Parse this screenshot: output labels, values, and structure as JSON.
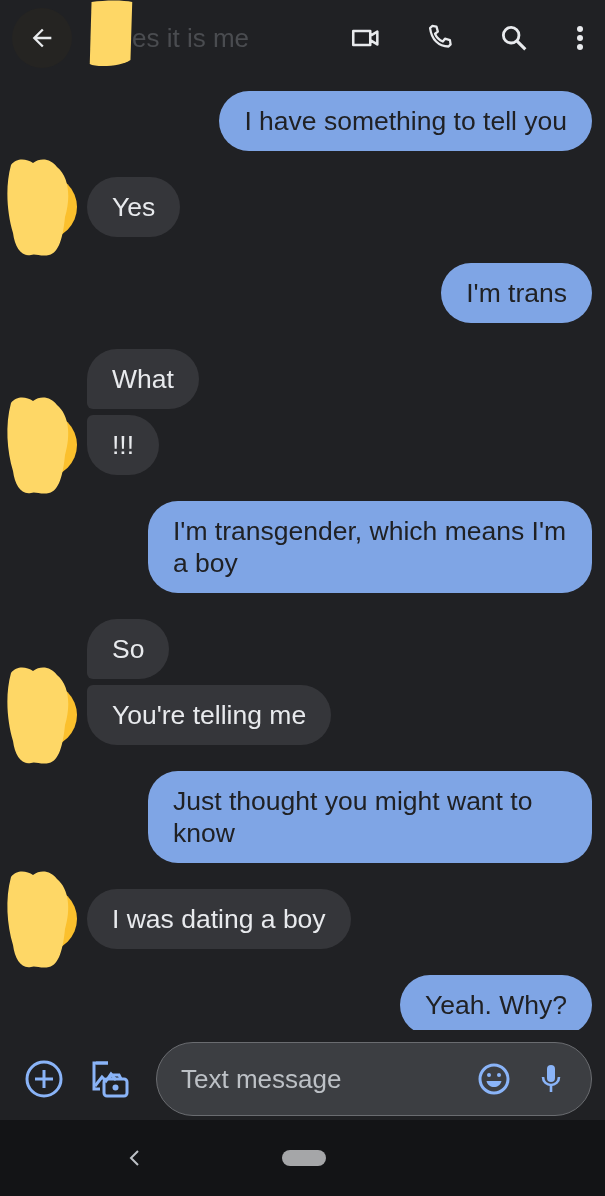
{
  "top_bar": {
    "title": "es it is me"
  },
  "conversation": [
    {
      "kind": "sent",
      "messages": [
        "I have something to tell you"
      ]
    },
    {
      "kind": "received",
      "messages": [
        "Yes"
      ]
    },
    {
      "kind": "sent",
      "messages": [
        "I'm trans"
      ]
    },
    {
      "kind": "received",
      "messages": [
        "What",
        "!!!"
      ]
    },
    {
      "kind": "sent",
      "messages": [
        "I'm transgender, which means I'm a boy"
      ]
    },
    {
      "kind": "received",
      "messages": [
        "So",
        "You're telling me"
      ]
    },
    {
      "kind": "sent",
      "messages": [
        "Just thought you might want to know"
      ]
    },
    {
      "kind": "received",
      "messages": [
        "I was dating a boy"
      ]
    },
    {
      "kind": "sent",
      "messages": [
        "Yeah. Why?"
      ]
    }
  ],
  "compose": {
    "placeholder": "Text message"
  }
}
